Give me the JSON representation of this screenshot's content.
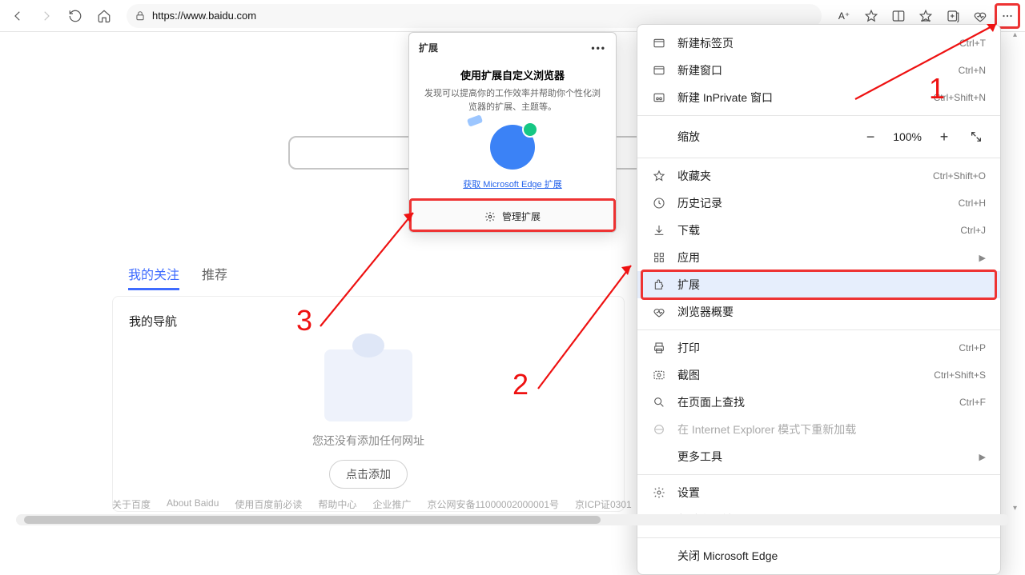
{
  "toolbar": {
    "url": "https://www.baidu.com",
    "read_aloud": "A⁺"
  },
  "page": {
    "tabs": {
      "follow": "我的关注",
      "recommend": "推荐"
    },
    "nav_title": "我的导航",
    "empty_text": "您还没有添加任何网址",
    "add_btn": "点击添加",
    "footer": [
      "关于百度",
      "About Baidu",
      "使用百度前必读",
      "帮助中心",
      "企业推广",
      "京公网安备11000002000001号",
      "京ICP证0301"
    ]
  },
  "ext_popup": {
    "title_tab": "扩展",
    "headline": "使用扩展自定义浏览器",
    "desc": "发现可以提高你的工作效率并帮助你个性化浏览器的扩展、主题等。",
    "link": "获取 Microsoft Edge 扩展",
    "manage": "管理扩展"
  },
  "menu": {
    "items": [
      {
        "id": "new-tab",
        "label": "新建标签页",
        "accel": "Ctrl+T",
        "icon": "tab"
      },
      {
        "id": "new-window",
        "label": "新建窗口",
        "accel": "Ctrl+N",
        "icon": "window"
      },
      {
        "id": "new-inprivate",
        "label": "新建 InPrivate 窗口",
        "accel": "Ctrl+Shift+N",
        "icon": "inprivate"
      }
    ],
    "zoom": {
      "label": "缩放",
      "value": "100%"
    },
    "items2": [
      {
        "id": "favorites",
        "label": "收藏夹",
        "accel": "Ctrl+Shift+O",
        "icon": "star"
      },
      {
        "id": "history",
        "label": "历史记录",
        "accel": "Ctrl+H",
        "icon": "clock"
      },
      {
        "id": "downloads",
        "label": "下载",
        "accel": "Ctrl+J",
        "icon": "download"
      },
      {
        "id": "apps",
        "label": "应用",
        "accel": "",
        "icon": "grid",
        "chev": true
      },
      {
        "id": "extensions",
        "label": "扩展",
        "accel": "",
        "icon": "puzzle",
        "highlight": true,
        "redbox": true
      },
      {
        "id": "essentials",
        "label": "浏览器概要",
        "accel": "",
        "icon": "pulse"
      }
    ],
    "items3": [
      {
        "id": "print",
        "label": "打印",
        "accel": "Ctrl+P",
        "icon": "print"
      },
      {
        "id": "screenshot",
        "label": "截图",
        "accel": "Ctrl+Shift+S",
        "icon": "capture"
      },
      {
        "id": "find",
        "label": "在页面上查找",
        "accel": "Ctrl+F",
        "icon": "find"
      },
      {
        "id": "ie-mode",
        "label": "在 Internet Explorer 模式下重新加载",
        "accel": "",
        "icon": "ie",
        "disabled": true
      },
      {
        "id": "more-tools",
        "label": "更多工具",
        "accel": "",
        "icon": "",
        "chev": true,
        "indent": true
      }
    ],
    "items4": [
      {
        "id": "settings",
        "label": "设置",
        "accel": "",
        "icon": "gear"
      },
      {
        "id": "help",
        "label": "帮助和反馈",
        "accel": "",
        "icon": "help",
        "chev": true
      }
    ],
    "close": {
      "label": "关闭 Microsoft Edge"
    }
  },
  "anno": {
    "n1": "1",
    "n2": "2",
    "n3": "3"
  }
}
